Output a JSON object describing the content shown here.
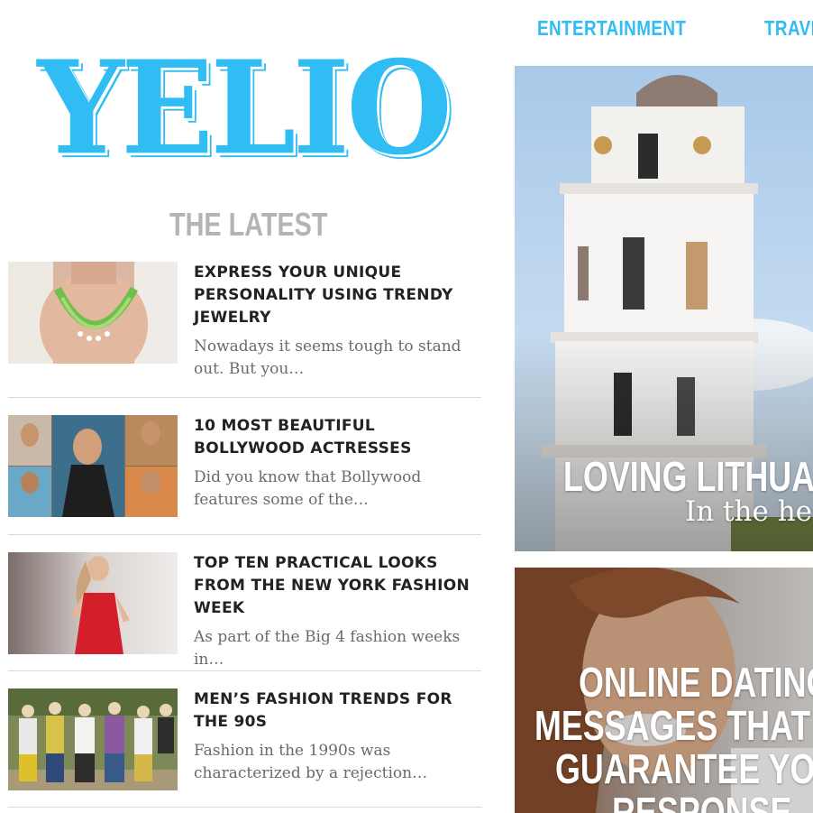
{
  "nav": {
    "items": [
      "ENTERTAINMENT",
      "TRAVEL"
    ]
  },
  "logo": {
    "text": "YELIO"
  },
  "latest": {
    "heading": "THE LATEST",
    "articles": [
      {
        "title": "EXPRESS YOUR UNIQUE PERSONALITY USING TRENDY JEWELRY",
        "excerpt": "Nowadays it seems tough to stand out. But you…",
        "image": "necklace-photo"
      },
      {
        "title": "10 MOST BEAUTIFUL BOLLYWOOD ACTRESSES",
        "excerpt": "Did you know that Bollywood features some of the…",
        "image": "actresses-collage"
      },
      {
        "title": "TOP TEN PRACTICAL LOOKS FROM THE NEW YORK FASHION WEEK",
        "excerpt": "As part of the Big 4 fashion weeks in…",
        "image": "red-dress-model"
      },
      {
        "title": "MEN’S FASHION TRENDS FOR THE 90S",
        "excerpt": "Fashion in the 1990s was characterized by a rejection…",
        "image": "90s-group-photo"
      }
    ]
  },
  "featured": [
    {
      "title": "LOVING LITHUANI",
      "subtitle": "In the hea",
      "image": "bell-tower-photo"
    },
    {
      "title_lines": [
        "ONLINE DATING",
        "MESSAGES THAT WI",
        "GUARANTEE YOU A",
        "RESPONSE"
      ],
      "image": "woman-smiling-photo"
    }
  ],
  "colors": {
    "accent": "#2fbdf4",
    "heading_gray": "#b4b4b4",
    "text_dark": "#222222",
    "text_muted": "#6a6a6a"
  }
}
